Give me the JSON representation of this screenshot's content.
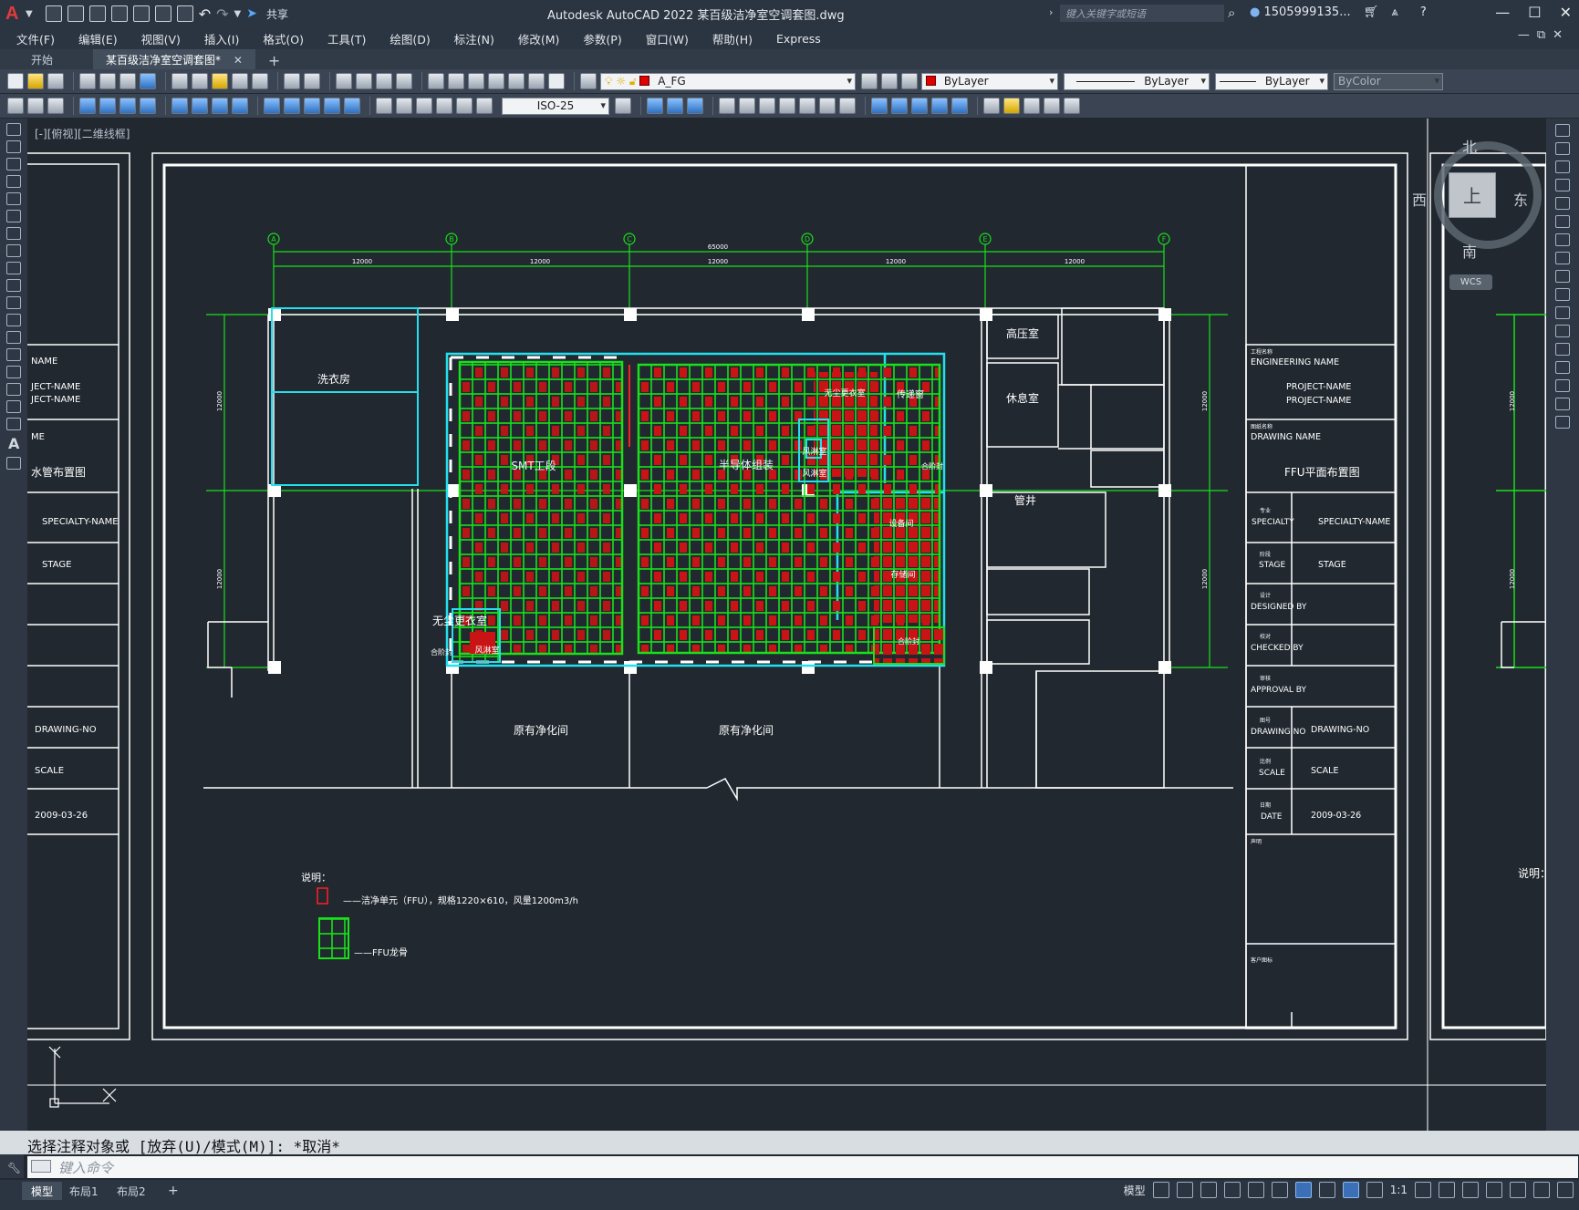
{
  "app": {
    "title": "Autodesk AutoCAD 2022    某百级洁净室空调套图.dwg",
    "share_label": "共享",
    "search_placeholder": "键入关键字或短语",
    "user_name": "1505999135...",
    "logo": "A"
  },
  "menu": [
    "文件(F)",
    "编辑(E)",
    "视图(V)",
    "插入(I)",
    "格式(O)",
    "工具(T)",
    "绘图(D)",
    "标注(N)",
    "修改(M)",
    "参数(P)",
    "窗口(W)",
    "帮助(H)",
    "Express"
  ],
  "tabs": {
    "start": "开始",
    "active": "某百级洁净室空调套图*",
    "close": "✕",
    "add": "+"
  },
  "toolbar": {
    "layer": "A_FG",
    "color": "ByLayer",
    "linetype": "ByLayer",
    "lineweight": "ByLayer",
    "plotstyle": "ByColor",
    "dimstyle": "ISO-25"
  },
  "viewport": {
    "label": "[-][俯视][二维线框]"
  },
  "viewcube": {
    "north": "北",
    "south": "南",
    "east": "东",
    "west": "西",
    "top": "上",
    "wcs": "WCS"
  },
  "drawing": {
    "grid_labels": [
      "A",
      "B",
      "C",
      "D",
      "E",
      "F"
    ],
    "bay_dim": "12000",
    "total_dim": "65000",
    "rooms": {
      "laundry": "洗衣房",
      "smt": "SMT工段",
      "semi": "半导体组装",
      "dust_free_dressing": "无尘更衣室",
      "hv": "高压室",
      "rest": "休息室",
      "shaft": "管井",
      "existing_a": "原有净化间",
      "existing_b": "原有净化间",
      "airlock": "风淋室",
      "airlock2": "风淋室",
      "airlock3": "风淋室",
      "trans": "传递窗",
      "pass": "合阶封",
      "dress2": "无尘更衣室",
      "equip": "设备间",
      "storage": "存储间",
      "inner": "合阶封",
      "corr": "合阶封"
    },
    "notes": {
      "title": "说明：",
      "ffu_unit": "——洁净单元（FFU），规格1220×610，风量1200m3/h",
      "ffu_frame": "——FFU龙骨"
    },
    "title_block": {
      "engineering_label": "工程名称",
      "engineering_name": "ENGINEERING NAME",
      "project_1": "PROJECT-NAME",
      "project_2": "PROJECT-NAME",
      "drawing_label": "图纸名称",
      "drawing_name": "DRAWING NAME",
      "sheet_title": "FFU平面布置图",
      "specialty_cn": "专业",
      "specialty": "SPECIALTY",
      "specialty_val": "SPECIALTY-NAME",
      "stage_cn": "阶段",
      "stage": "STAGE",
      "stage_val": "STAGE",
      "designed_cn": "设计",
      "designed": "DESIGNED BY",
      "checked_cn": "校对",
      "checked": "CHECKED BY",
      "approval_cn": "审核",
      "approval": "APPROVAL BY",
      "drawing_no_cn": "图号",
      "drawing_no": "DRAWING NO",
      "drawing_no_val": "DRAWING-NO",
      "scale_cn": "比例",
      "scale": "SCALE",
      "scale_val": "SCALE",
      "date_cn": "日期",
      "date": "DATE",
      "date_val": "2009-03-26",
      "notes_cn": "声明",
      "client_cn": "客户图标"
    },
    "left_sheet": {
      "name": "NAME",
      "project_1": "JECT-NAME",
      "project_2": "JECT-NAME",
      "drawing": "ME",
      "title": "水管布置图",
      "specialty": "SPECIALTY-NAME",
      "stage": "STAGE",
      "drawing_no": "DRAWING-NO",
      "scale": "SCALE",
      "date": "2009-03-26"
    },
    "right_sheet_note": "说明："
  },
  "command": {
    "history": "选择注释对象或 [放弃(U)/模式(M)]: *取消*",
    "placeholder": "键入命令"
  },
  "status": {
    "layouts": [
      "模型",
      "布局1",
      "布局2"
    ],
    "add": "+",
    "model_btn": "模型",
    "scale": "1:1"
  }
}
